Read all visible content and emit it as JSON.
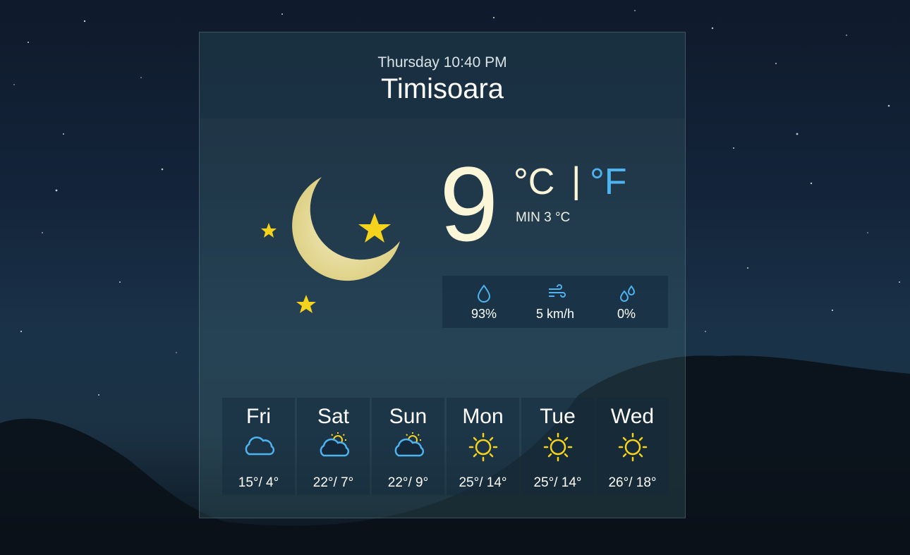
{
  "header": {
    "day": "Thursday",
    "time": "10:40 PM",
    "city": "Timisoara"
  },
  "current": {
    "temperature": "9",
    "unit_c": "°C",
    "separator": "|",
    "unit_f": "°F",
    "min_label": "MIN 3 °C",
    "condition_icon": "moon-stars-icon"
  },
  "stats": [
    {
      "icon": "humidity-drop-icon",
      "value": "93%"
    },
    {
      "icon": "wind-icon",
      "value": "5 km/h"
    },
    {
      "icon": "precipitation-drops-icon",
      "value": "0%"
    }
  ],
  "forecast": [
    {
      "day": "Fri",
      "icon": "cloud-icon",
      "temps": "15°/ 4°"
    },
    {
      "day": "Sat",
      "icon": "partly-cloudy-icon",
      "temps": "22°/ 7°"
    },
    {
      "day": "Sun",
      "icon": "partly-cloudy-icon",
      "temps": "22°/ 9°"
    },
    {
      "day": "Mon",
      "icon": "sun-icon",
      "temps": "25°/ 14°"
    },
    {
      "day": "Tue",
      "icon": "sun-icon",
      "temps": "25°/ 14°"
    },
    {
      "day": "Wed",
      "icon": "sun-icon",
      "temps": "26°/ 18°"
    }
  ],
  "colors": {
    "accent_blue": "#4fb3f0",
    "sun_yellow": "#f5d21c",
    "moon_cream": "#fbf0b4"
  }
}
